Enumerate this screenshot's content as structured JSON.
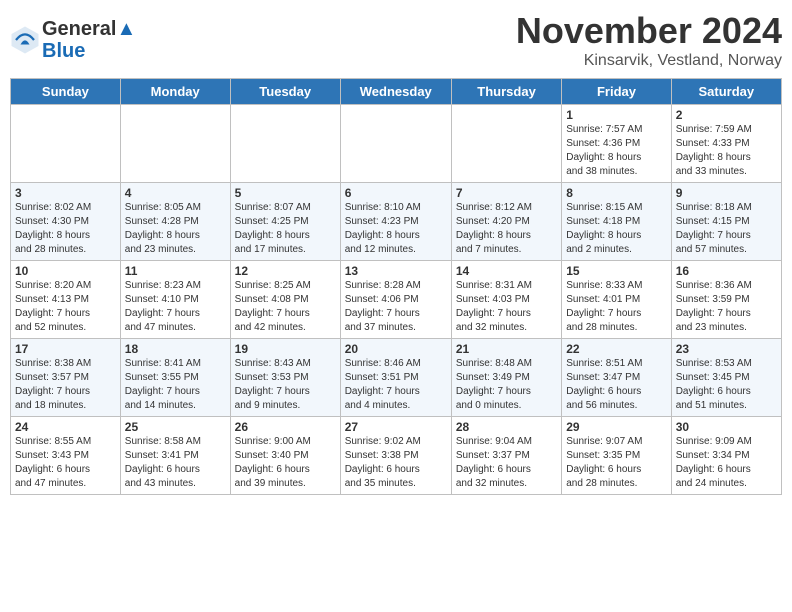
{
  "header": {
    "logo_line1": "General",
    "logo_line2": "Blue",
    "month_title": "November 2024",
    "location": "Kinsarvik, Vestland, Norway"
  },
  "weekdays": [
    "Sunday",
    "Monday",
    "Tuesday",
    "Wednesday",
    "Thursday",
    "Friday",
    "Saturday"
  ],
  "weeks": [
    [
      {
        "day": "",
        "info": ""
      },
      {
        "day": "",
        "info": ""
      },
      {
        "day": "",
        "info": ""
      },
      {
        "day": "",
        "info": ""
      },
      {
        "day": "",
        "info": ""
      },
      {
        "day": "1",
        "info": "Sunrise: 7:57 AM\nSunset: 4:36 PM\nDaylight: 8 hours\nand 38 minutes."
      },
      {
        "day": "2",
        "info": "Sunrise: 7:59 AM\nSunset: 4:33 PM\nDaylight: 8 hours\nand 33 minutes."
      }
    ],
    [
      {
        "day": "3",
        "info": "Sunrise: 8:02 AM\nSunset: 4:30 PM\nDaylight: 8 hours\nand 28 minutes."
      },
      {
        "day": "4",
        "info": "Sunrise: 8:05 AM\nSunset: 4:28 PM\nDaylight: 8 hours\nand 23 minutes."
      },
      {
        "day": "5",
        "info": "Sunrise: 8:07 AM\nSunset: 4:25 PM\nDaylight: 8 hours\nand 17 minutes."
      },
      {
        "day": "6",
        "info": "Sunrise: 8:10 AM\nSunset: 4:23 PM\nDaylight: 8 hours\nand 12 minutes."
      },
      {
        "day": "7",
        "info": "Sunrise: 8:12 AM\nSunset: 4:20 PM\nDaylight: 8 hours\nand 7 minutes."
      },
      {
        "day": "8",
        "info": "Sunrise: 8:15 AM\nSunset: 4:18 PM\nDaylight: 8 hours\nand 2 minutes."
      },
      {
        "day": "9",
        "info": "Sunrise: 8:18 AM\nSunset: 4:15 PM\nDaylight: 7 hours\nand 57 minutes."
      }
    ],
    [
      {
        "day": "10",
        "info": "Sunrise: 8:20 AM\nSunset: 4:13 PM\nDaylight: 7 hours\nand 52 minutes."
      },
      {
        "day": "11",
        "info": "Sunrise: 8:23 AM\nSunset: 4:10 PM\nDaylight: 7 hours\nand 47 minutes."
      },
      {
        "day": "12",
        "info": "Sunrise: 8:25 AM\nSunset: 4:08 PM\nDaylight: 7 hours\nand 42 minutes."
      },
      {
        "day": "13",
        "info": "Sunrise: 8:28 AM\nSunset: 4:06 PM\nDaylight: 7 hours\nand 37 minutes."
      },
      {
        "day": "14",
        "info": "Sunrise: 8:31 AM\nSunset: 4:03 PM\nDaylight: 7 hours\nand 32 minutes."
      },
      {
        "day": "15",
        "info": "Sunrise: 8:33 AM\nSunset: 4:01 PM\nDaylight: 7 hours\nand 28 minutes."
      },
      {
        "day": "16",
        "info": "Sunrise: 8:36 AM\nSunset: 3:59 PM\nDaylight: 7 hours\nand 23 minutes."
      }
    ],
    [
      {
        "day": "17",
        "info": "Sunrise: 8:38 AM\nSunset: 3:57 PM\nDaylight: 7 hours\nand 18 minutes."
      },
      {
        "day": "18",
        "info": "Sunrise: 8:41 AM\nSunset: 3:55 PM\nDaylight: 7 hours\nand 14 minutes."
      },
      {
        "day": "19",
        "info": "Sunrise: 8:43 AM\nSunset: 3:53 PM\nDaylight: 7 hours\nand 9 minutes."
      },
      {
        "day": "20",
        "info": "Sunrise: 8:46 AM\nSunset: 3:51 PM\nDaylight: 7 hours\nand 4 minutes."
      },
      {
        "day": "21",
        "info": "Sunrise: 8:48 AM\nSunset: 3:49 PM\nDaylight: 7 hours\nand 0 minutes."
      },
      {
        "day": "22",
        "info": "Sunrise: 8:51 AM\nSunset: 3:47 PM\nDaylight: 6 hours\nand 56 minutes."
      },
      {
        "day": "23",
        "info": "Sunrise: 8:53 AM\nSunset: 3:45 PM\nDaylight: 6 hours\nand 51 minutes."
      }
    ],
    [
      {
        "day": "24",
        "info": "Sunrise: 8:55 AM\nSunset: 3:43 PM\nDaylight: 6 hours\nand 47 minutes."
      },
      {
        "day": "25",
        "info": "Sunrise: 8:58 AM\nSunset: 3:41 PM\nDaylight: 6 hours\nand 43 minutes."
      },
      {
        "day": "26",
        "info": "Sunrise: 9:00 AM\nSunset: 3:40 PM\nDaylight: 6 hours\nand 39 minutes."
      },
      {
        "day": "27",
        "info": "Sunrise: 9:02 AM\nSunset: 3:38 PM\nDaylight: 6 hours\nand 35 minutes."
      },
      {
        "day": "28",
        "info": "Sunrise: 9:04 AM\nSunset: 3:37 PM\nDaylight: 6 hours\nand 32 minutes."
      },
      {
        "day": "29",
        "info": "Sunrise: 9:07 AM\nSunset: 3:35 PM\nDaylight: 6 hours\nand 28 minutes."
      },
      {
        "day": "30",
        "info": "Sunrise: 9:09 AM\nSunset: 3:34 PM\nDaylight: 6 hours\nand 24 minutes."
      }
    ]
  ]
}
